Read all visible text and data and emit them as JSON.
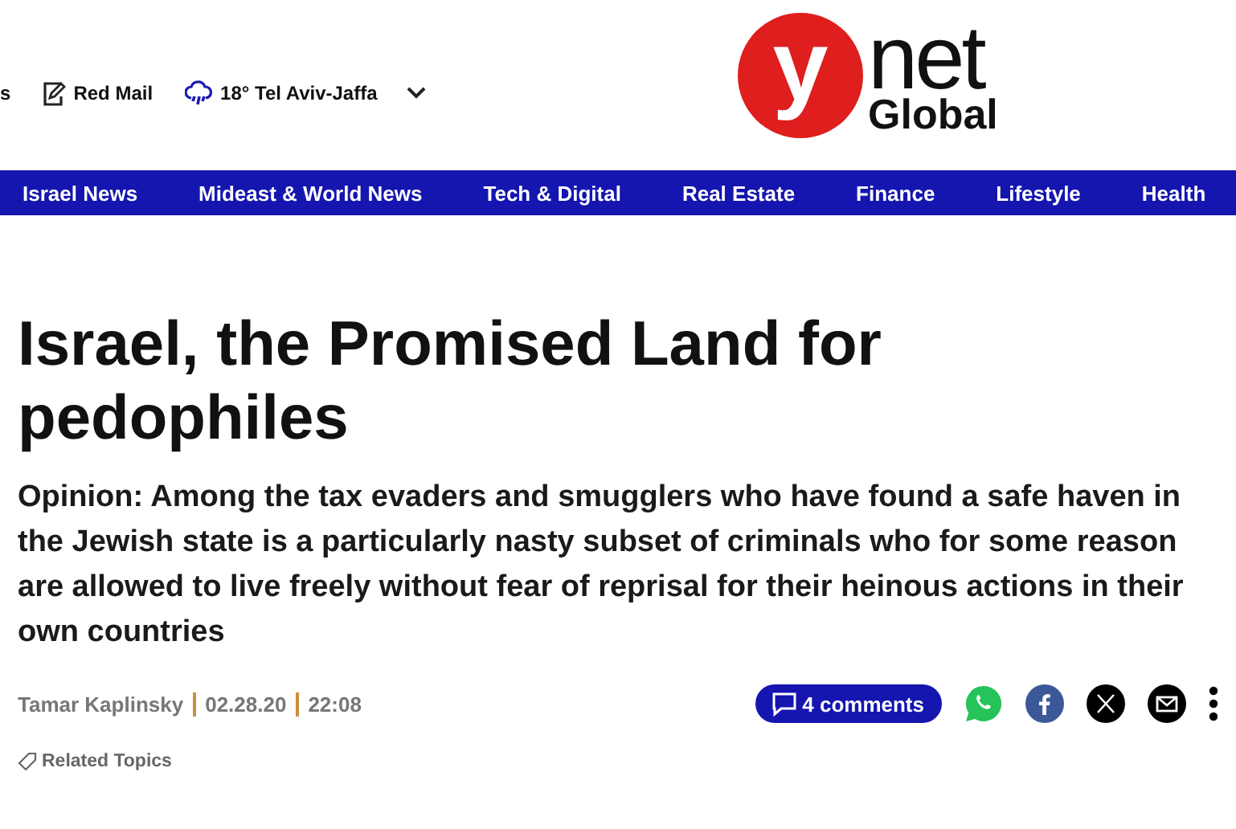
{
  "top_links": [
    {
      "label": "s",
      "kind": "text"
    },
    {
      "label": "Red Mail",
      "kind": "mail"
    },
    {
      "label": "18° Tel Aviv-Jaffa",
      "kind": "weather"
    }
  ],
  "logo": {
    "letter": "y",
    "word": "net",
    "edition": "Global"
  },
  "nav": [
    {
      "label": "Israel News"
    },
    {
      "label": "Mideast & World News"
    },
    {
      "label": "Tech & Digital"
    },
    {
      "label": "Real Estate"
    },
    {
      "label": "Finance"
    },
    {
      "label": "Lifestyle"
    },
    {
      "label": "Health"
    }
  ],
  "article": {
    "title": "Israel, the Promised Land for pedophiles",
    "subtitle": "Opinion: Among the tax evaders and smugglers who have found a safe haven in the Jewish state is a particularly nasty subset of criminals who for some reason are allowed to live freely without fear of reprisal for their heinous actions in their own countries",
    "author": "Tamar Kaplinsky",
    "date": "02.28.20",
    "time": "22:08",
    "comments": "4 comments",
    "related": "Related Topics"
  }
}
